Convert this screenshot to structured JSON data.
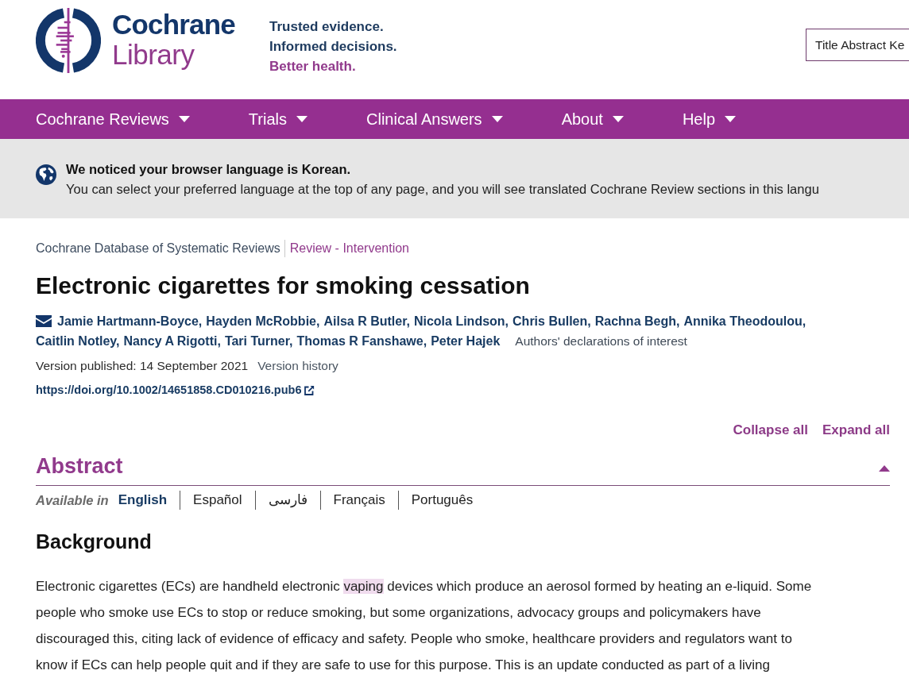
{
  "header": {
    "logo": {
      "line_1": "Cochrane",
      "line_2": "Library"
    },
    "tagline": [
      {
        "text": "Trusted evidence.",
        "accent": false
      },
      {
        "text": "Informed decisions.",
        "accent": false
      },
      {
        "text": "Better health.",
        "accent": true
      }
    ],
    "search_scope": {
      "value": "Title Abstract Ke"
    }
  },
  "nav": {
    "items": [
      {
        "label": "Cochrane Reviews",
        "has_menu": true
      },
      {
        "label": "Trials",
        "has_menu": true
      },
      {
        "label": "Clinical Answers",
        "has_menu": true
      },
      {
        "label": "About",
        "has_menu": true
      },
      {
        "label": "Help",
        "has_menu": true
      }
    ]
  },
  "language_notice": {
    "title": "We noticed your browser language is Korean.",
    "message": "You can select your preferred language at the top of any page, and you will see translated Cochrane Review sections in this langu"
  },
  "article": {
    "breadcrumb": [
      {
        "text": "Cochrane Database of Systematic Reviews",
        "kind": "database"
      },
      {
        "text": "Review - Intervention",
        "kind": "type"
      }
    ],
    "title": "Electronic cigarettes for smoking cessation",
    "authors": [
      "Jamie Hartmann-Boyce,",
      "Hayden McRobbie,",
      "Ailsa R Butler,",
      "Nicola Lindson,",
      "Chris Bullen,",
      "Rachna Begh,",
      "Annika Theodoulou,",
      "Caitlin Notley,",
      "Nancy A Rigotti,",
      "Tari Turner,",
      "Thomas R Fanshawe,",
      "Peter Hajek"
    ],
    "declarations_link": "Authors' declarations of interest",
    "version": {
      "published": "Version published: 14 September 2021",
      "history_link": "Version history"
    },
    "doi": "https://doi.org/10.1002/14651858.CD010216.pub6",
    "actions": [
      "Collapse all",
      "Expand all"
    ]
  },
  "abstract": {
    "heading": "Abstract",
    "expanded": true,
    "available_in_label": "Available in",
    "languages": [
      {
        "label": "English",
        "selected": true
      },
      {
        "label": "Español",
        "selected": false
      },
      {
        "label": "فارسی",
        "selected": false
      },
      {
        "label": "Français",
        "selected": false
      },
      {
        "label": "Português",
        "selected": false
      }
    ],
    "sections": [
      {
        "heading": "Background",
        "segments": [
          {
            "text": "Electronic cigarettes (ECs) are handheld electronic ",
            "highlighted": false
          },
          {
            "text": "vaping",
            "highlighted": true
          },
          {
            "text": " devices which produce an aerosol formed by heating an e-liquid. Some\npeople who smoke use ECs to stop or reduce smoking, but some organizations, advocacy groups and policymakers have\ndiscouraged this, citing lack of evidence of efficacy and safety. People who smoke, healthcare providers and regulators want to\nknow if ECs can help people quit and if they are safe to use for this purpose. This is an update conducted as part of a living",
            "highlighted": false
          }
        ]
      }
    ]
  }
}
